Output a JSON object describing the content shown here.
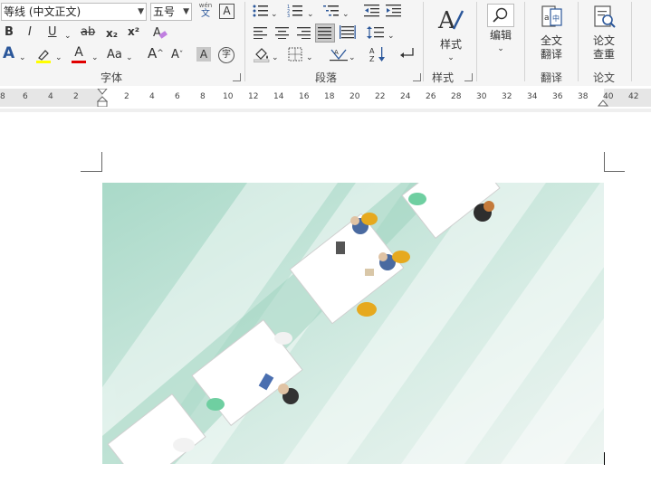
{
  "ribbon": {
    "font": {
      "name": "等线 (中文正文)",
      "size": "五号",
      "pinyin_label": "wén",
      "pinyin_char": "文",
      "border_char": "A",
      "bold": "B",
      "italic": "I",
      "underline": "U",
      "strike": "ab",
      "subscript": "x₂",
      "superscript": "x²",
      "text_effect": "A",
      "font_color": "A",
      "change_case": "Aa",
      "grow": "A",
      "shrink": "A",
      "shade": "A",
      "enclose": "字",
      "group_label": "字体"
    },
    "paragraph": {
      "group_label": "段落"
    },
    "styles": {
      "button_label": "样式",
      "group_label": "样式"
    },
    "editing": {
      "button_label": "编辑"
    },
    "translate": {
      "button_label_1": "全文",
      "button_label_2": "翻译",
      "group_label": "翻译"
    },
    "thesis": {
      "button_label_1": "论文",
      "button_label_2": "查重",
      "group_label": "论文"
    }
  },
  "ruler": {
    "ticks_left": [
      "8",
      "6",
      "4",
      "2"
    ],
    "ticks_right": [
      "2",
      "4",
      "6",
      "8",
      "10",
      "12",
      "14",
      "16",
      "18",
      "20",
      "22",
      "24",
      "26",
      "28",
      "30",
      "32",
      "34",
      "36",
      "38",
      "40",
      "42"
    ]
  },
  "colors": {
    "accent": "#2b579a",
    "highlight": "#ffff00",
    "font_red": "#e00000",
    "ribbon_bg": "#f5f5f5",
    "ruler_bg": "#e6e6e6"
  }
}
